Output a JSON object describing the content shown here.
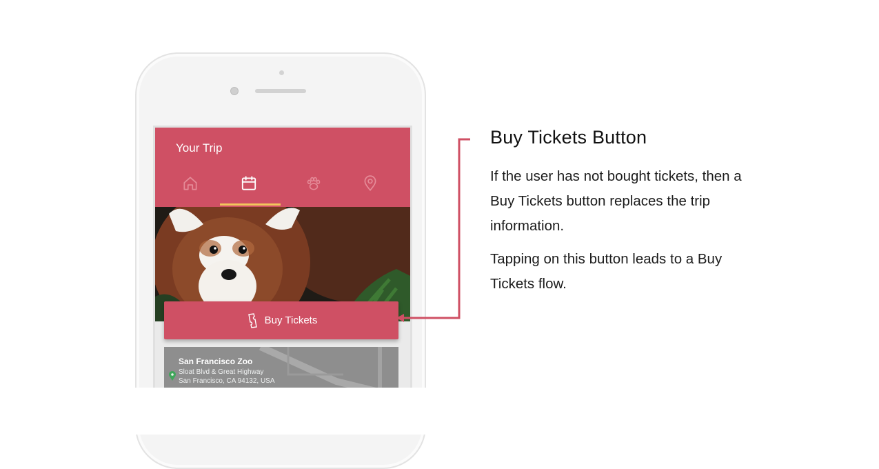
{
  "app": {
    "title": "Your Trip",
    "tabs": [
      {
        "icon": "home-icon",
        "active": false
      },
      {
        "icon": "calendar-icon",
        "active": true
      },
      {
        "icon": "paw-icon",
        "active": false
      },
      {
        "icon": "location-pin-icon",
        "active": false
      }
    ],
    "buy_tickets_label": "Buy Tickets",
    "location": {
      "name": "San Francisco Zoo",
      "address_line1": "Sloat Blvd & Great Highway",
      "address_line2": "San Francisco, CA 94132, USA"
    }
  },
  "callout": {
    "title": "Buy Tickets Button",
    "paragraph1": "If the user has not bought tickets, then a Buy Tickets button replaces the trip information.",
    "paragraph2": "Tapping on this button leads to a Buy Tickets flow."
  },
  "colors": {
    "brand": "#cf5064",
    "tab_indicator": "#f1c65c",
    "connector": "#cf5064"
  }
}
